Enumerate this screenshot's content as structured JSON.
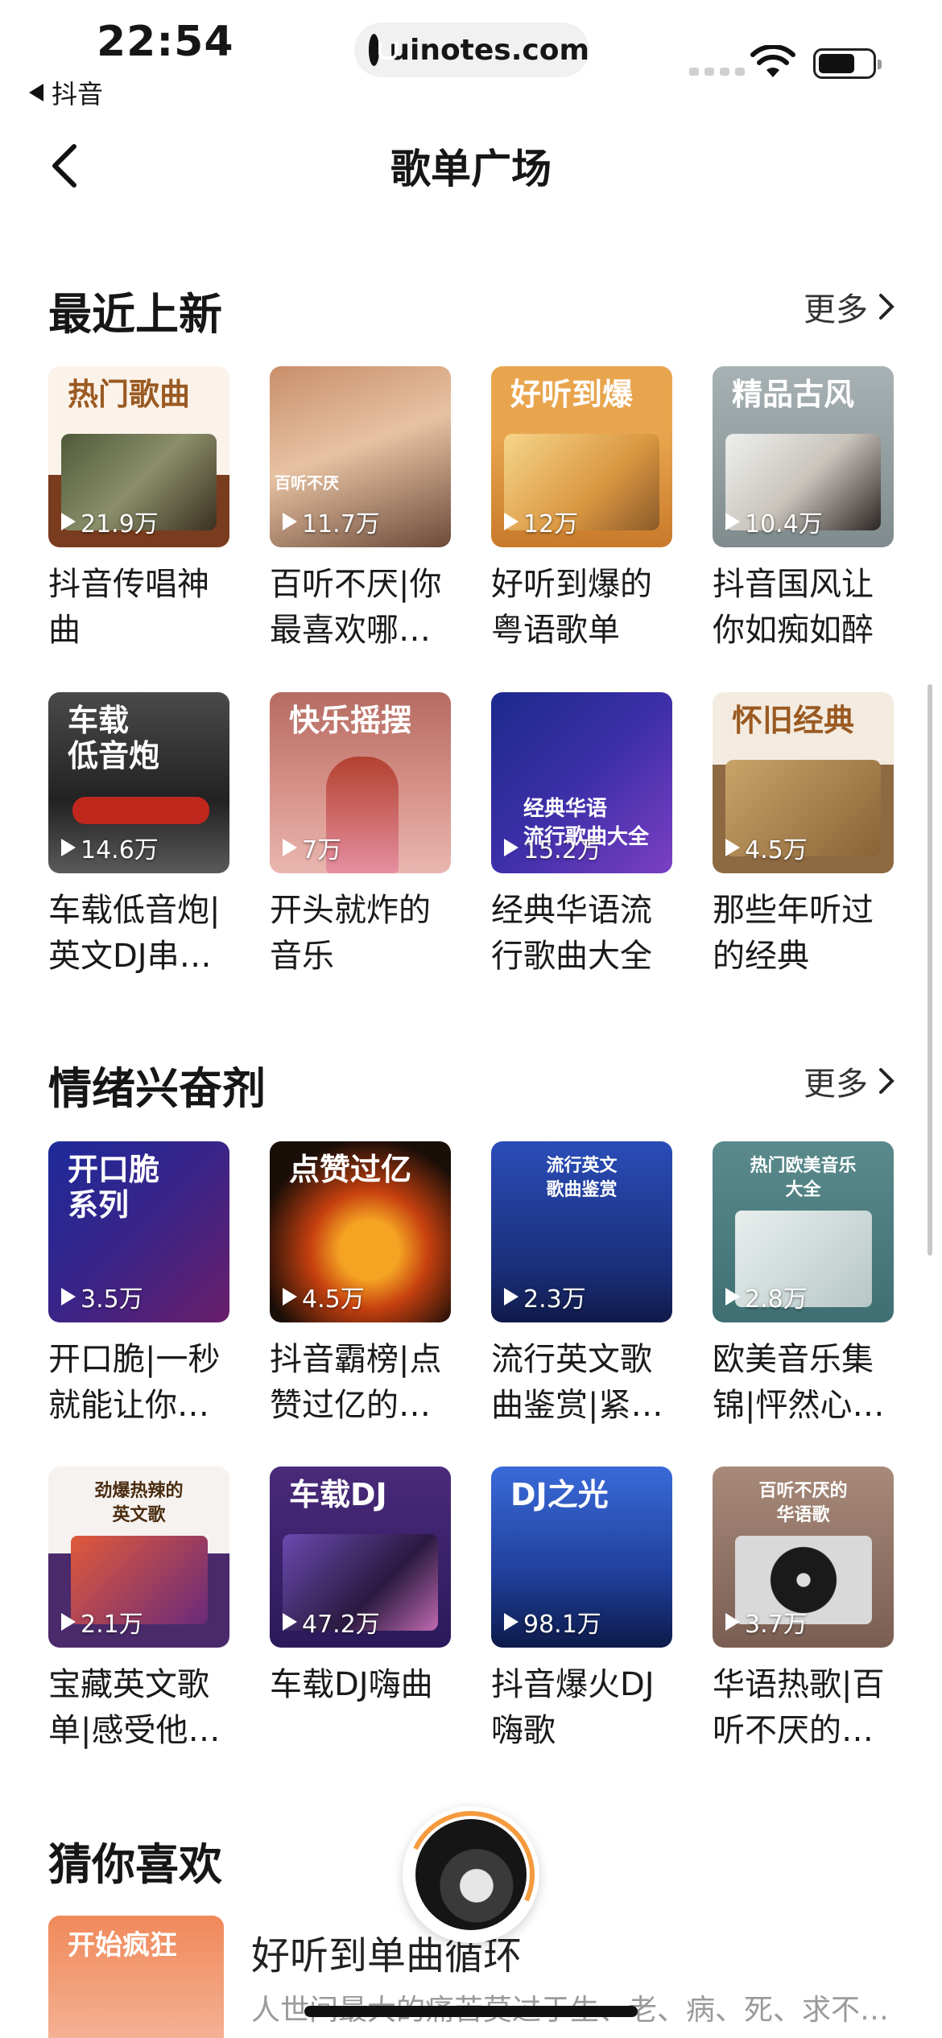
{
  "status_bar": {
    "time": "22:54",
    "back_app": "抖音",
    "url": "uinotes.com"
  },
  "header": {
    "title": "歌单广场"
  },
  "sections": [
    {
      "title": "最近上新",
      "more": "更多",
      "rows": [
        [
          {
            "label": "热门歌曲",
            "plays": "21.9万",
            "title": "抖音传唱神曲"
          },
          {
            "label": "百听不厌",
            "plays": "11.7万",
            "title": "百听不厌|你最喜欢哪…"
          },
          {
            "label": "好听到爆",
            "plays": "12万",
            "title": "好听到爆的粤语歌单"
          },
          {
            "label": "精品古风",
            "plays": "10.4万",
            "title": "抖音国风让你如痴如醉"
          }
        ],
        [
          {
            "label": "车载\n低音炮",
            "plays": "14.6万",
            "title": "车载低音炮|英文DJ串…"
          },
          {
            "label": "快乐摇摆",
            "plays": "7万",
            "title": "开头就炸的音乐"
          },
          {
            "label": "经典华语\n流行歌曲大全",
            "plays": "15.2万",
            "title": "经典华语流行歌曲大全"
          },
          {
            "label": "怀旧经典",
            "plays": "4.5万",
            "title": "那些年听过的经典"
          }
        ]
      ]
    },
    {
      "title": "情绪兴奋剂",
      "more": "更多",
      "rows": [
        [
          {
            "label": "开口脆\n系列",
            "plays": "3.5万",
            "title": "开口脆|一秒就能让你…"
          },
          {
            "label": "点赞过亿",
            "plays": "4.5万",
            "title": "抖音霸榜|点赞过亿的…"
          },
          {
            "label": "流行英文\n歌曲鉴赏",
            "plays": "2.3万",
            "title": "流行英文歌曲鉴赏|紧…"
          },
          {
            "label": "热门欧美音乐\n大全",
            "plays": "2.8万",
            "title": "欧美音乐集锦|怦然心…"
          }
        ],
        [
          {
            "label": "劲爆热辣的\n英文歌",
            "plays": "2.1万",
            "title": "宝藏英文歌单|感受他…"
          },
          {
            "label": "车载DJ",
            "plays": "47.2万",
            "title": "车载DJ嗨曲"
          },
          {
            "label": "DJ之光",
            "plays": "98.1万",
            "title": "抖音爆火DJ嗨歌"
          },
          {
            "label": "百听不厌的\n华语歌",
            "plays": "3.7万",
            "title": "华语热歌|百听不厌的…"
          }
        ]
      ]
    },
    {
      "title": "猜你喜欢"
    }
  ],
  "recommend": {
    "cover_label": "开始疯狂",
    "title": "好听到单曲循环",
    "desc": "人世间最大的痛苦莫过于生、老、病、死、求不…"
  },
  "colors": {
    "accent": "#f59a3d"
  }
}
